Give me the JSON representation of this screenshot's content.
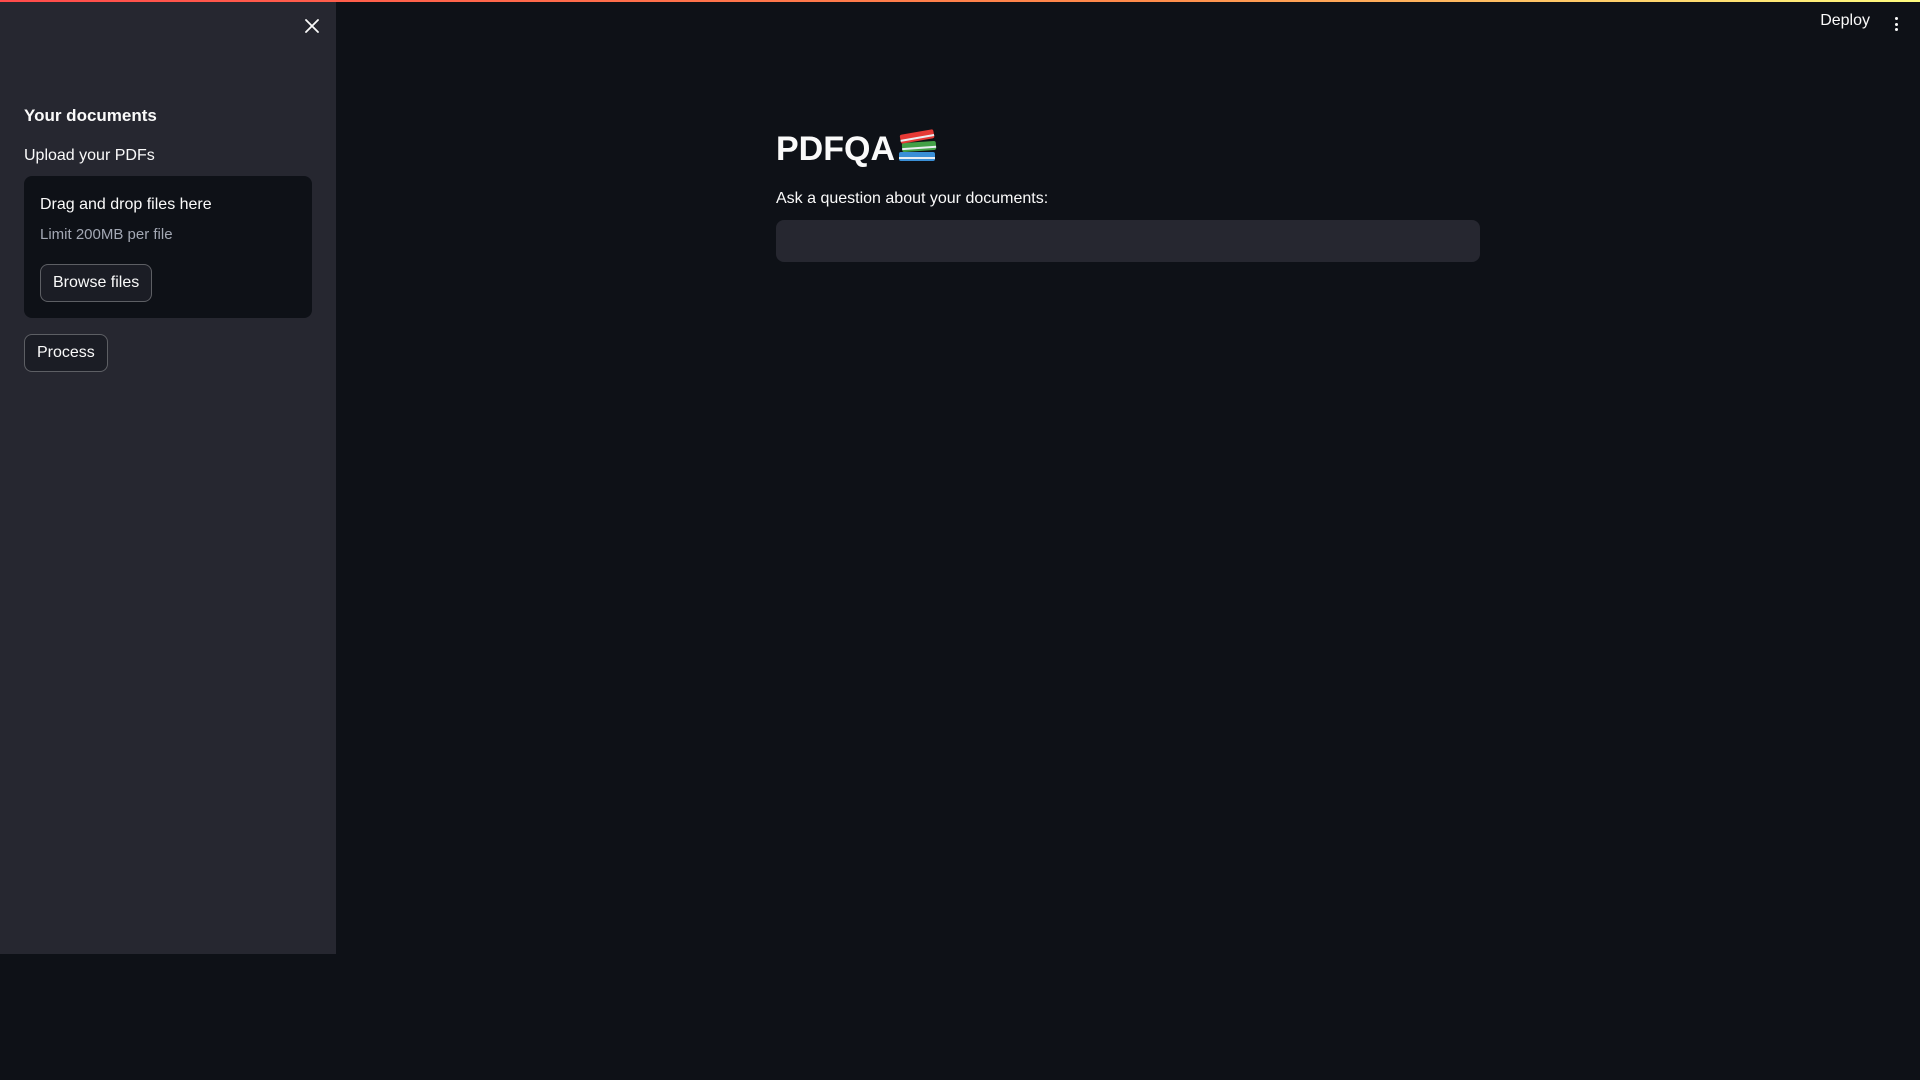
{
  "sidebar": {
    "heading": "Your documents",
    "uploader_label": "Upload your PDFs",
    "dropzone_title": "Drag and drop files here",
    "dropzone_limit": "Limit 200MB per file",
    "browse_label": "Browse files",
    "process_label": "Process",
    "close_icon": "close-icon"
  },
  "toolbar": {
    "deploy_label": "Deploy",
    "menu_icon": "vertical-ellipsis-icon"
  },
  "main": {
    "title": "PDFQA",
    "title_icon": "books-icon",
    "question_label": "Ask a question about your documents:",
    "question_value": ""
  },
  "colors": {
    "background": "#0e1117",
    "sidebar": "#262730",
    "input": "#262730",
    "accent": "#ff4b4b"
  }
}
